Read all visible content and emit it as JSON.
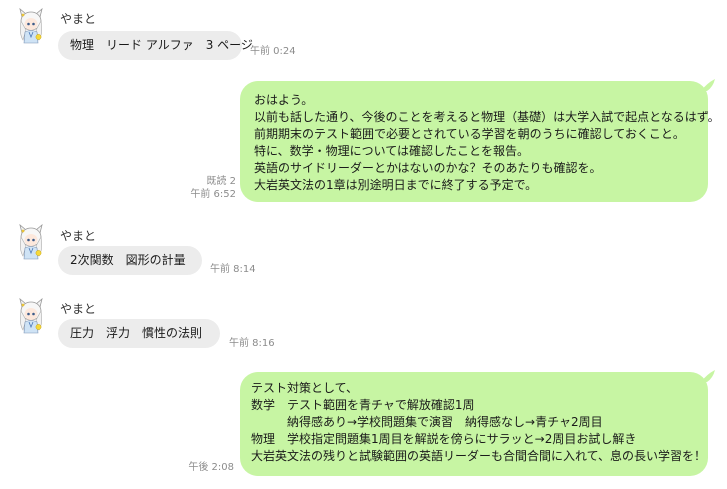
{
  "colors": {
    "incoming_bubble": "#ececec",
    "outgoing_bubble": "#c7f5a3",
    "meta_text": "#8c8c8c"
  },
  "messages": [
    {
      "sender": "やまと",
      "avatar_icon": "anime-character-avatar-icon",
      "text": "物理　リード アルファ　3 ページ",
      "time": "午前 0:24"
    },
    {
      "read": "既読 2",
      "time": "午前 6:52",
      "text": "おはよう。\n以前も話した通り、今後のことを考えると物理（基礎）は大学入試で起点となるはず。\n前期期末のテスト範囲で必要とされている学習を朝のうちに確認しておくこと。\n特に、数学・物理については確認したことを報告。\n英語のサイドリーダーとかはないのかな？そのあたりも確認を。\n大岩英文法の1章は別途明日までに終了する予定で。"
    },
    {
      "sender": "やまと",
      "avatar_icon": "anime-character-avatar-icon",
      "text": "2次関数　図形の計量",
      "time": "午前 8:14"
    },
    {
      "sender": "やまと",
      "avatar_icon": "anime-character-avatar-icon",
      "text": "圧力　浮力　慣性の法則",
      "time": "午前 8:16"
    },
    {
      "time": "午後 2:08",
      "text": "テスト対策として、\n数学　テスト範囲を青チャで解放確認1周\n　　　納得感あり→学校問題集で演習　納得感なし→青チャ2周目\n物理　学校指定問題集1周目を解説を傍らにサラッと→2周目お試し解き\n大岩英文法の残りと試験範囲の英語リーダーも合間合間に入れて、息の長い学習を！"
    }
  ]
}
